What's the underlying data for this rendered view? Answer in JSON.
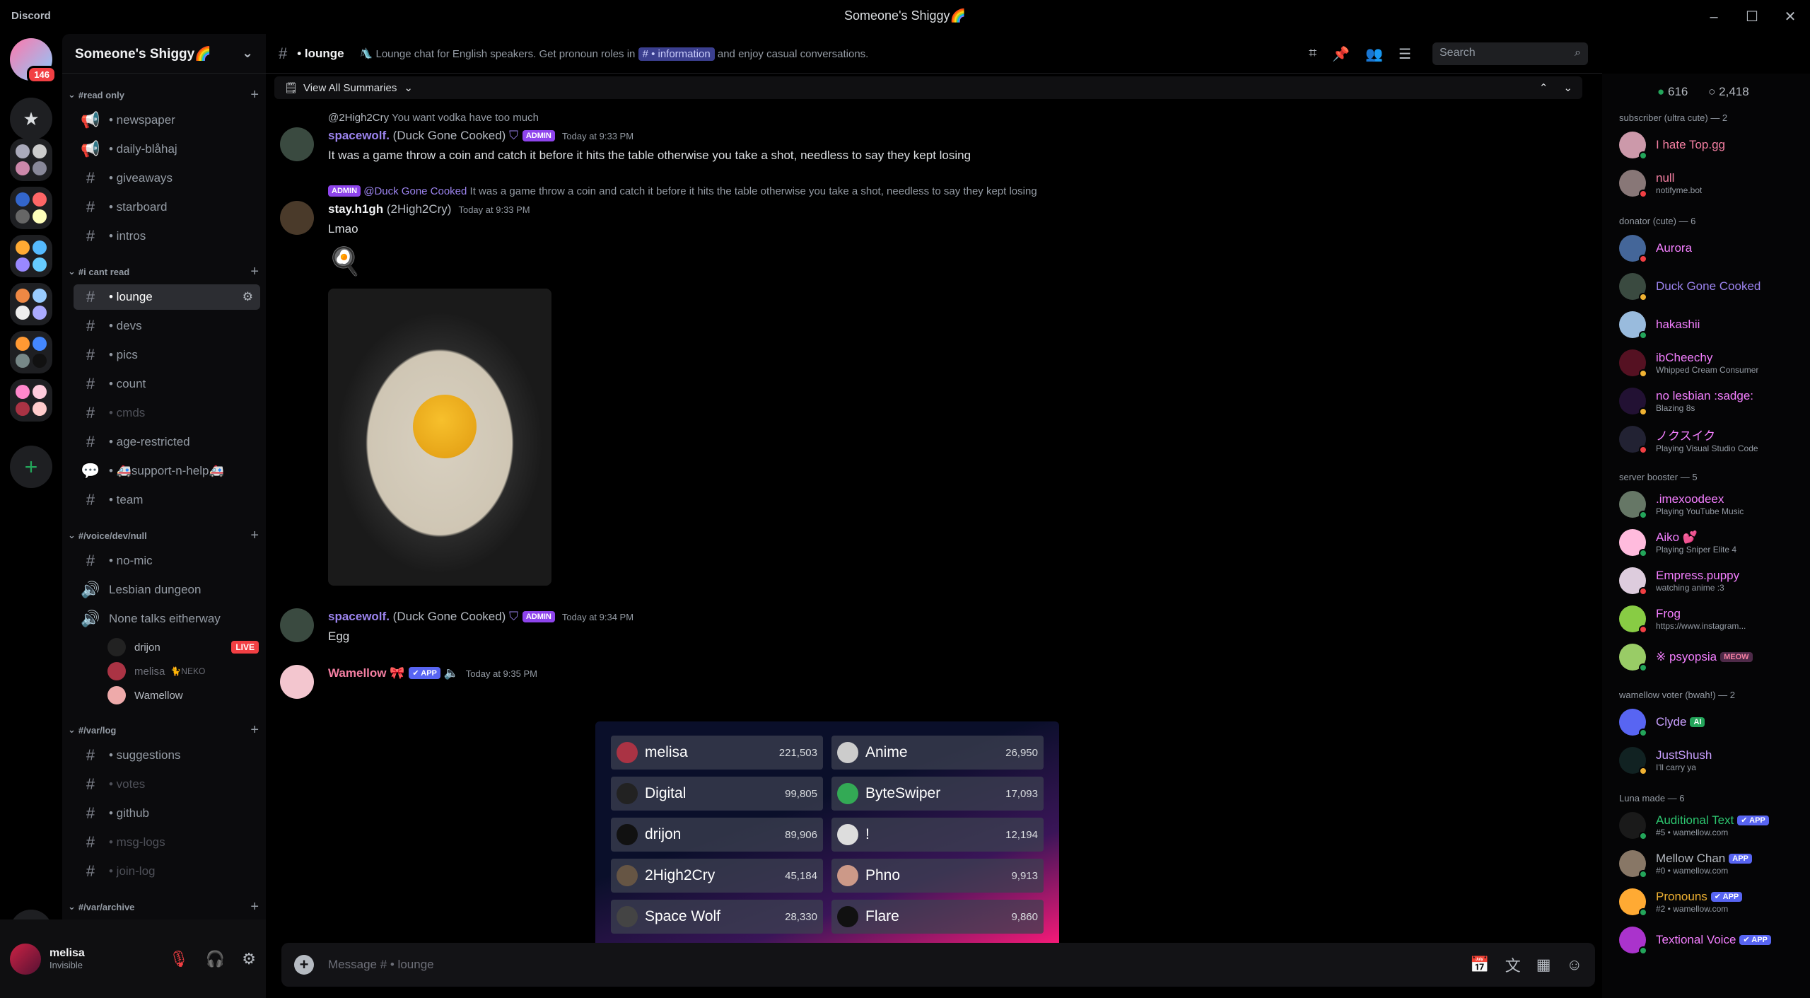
{
  "window": {
    "brand": "Discord",
    "title": "Someone's Shiggy🌈"
  },
  "guilds": {
    "badge": "146"
  },
  "server": {
    "name": "Someone's Shiggy🌈"
  },
  "categories": [
    {
      "name": "#read only",
      "channels": [
        {
          "label": "• newspaper",
          "icon": "megaphone"
        },
        {
          "label": "• daily-blåhaj",
          "icon": "megaphone"
        },
        {
          "label": "• giveaways",
          "icon": "hash"
        },
        {
          "label": "• starboard",
          "icon": "hash"
        },
        {
          "label": "• intros",
          "icon": "hash"
        }
      ]
    },
    {
      "name": "#i cant read",
      "channels": [
        {
          "label": "• lounge",
          "icon": "hash"
        },
        {
          "label": "• devs",
          "icon": "hash"
        },
        {
          "label": "• pics",
          "icon": "hash"
        },
        {
          "label": "• count",
          "icon": "hash"
        },
        {
          "label": "• cmds",
          "icon": "hash"
        },
        {
          "label": "• age-restricted",
          "icon": "hash"
        },
        {
          "label": "• 🚑support-n-help🚑",
          "icon": "forum"
        },
        {
          "label": "• team",
          "icon": "hash"
        }
      ]
    },
    {
      "name": "#/voice/dev/null",
      "channels": [
        {
          "label": "• no-mic",
          "icon": "hash"
        },
        {
          "label": "Lesbian dungeon",
          "icon": "speaker"
        },
        {
          "label": "None talks eitherway",
          "icon": "speaker"
        }
      ],
      "voice_users": [
        {
          "name": "drijon",
          "tag": "LIVE"
        },
        {
          "name": "melisa",
          "tag": "🐈NEKO"
        },
        {
          "name": "Wamellow",
          "tag": ""
        }
      ]
    },
    {
      "name": "#/var/log",
      "channels": [
        {
          "label": "• suggestions",
          "icon": "hash"
        },
        {
          "label": "• votes",
          "icon": "hash"
        },
        {
          "label": "• github",
          "icon": "hash"
        },
        {
          "label": "• msg-logs",
          "icon": "hash"
        },
        {
          "label": "• join-log",
          "icon": "hash"
        }
      ]
    },
    {
      "name": "#/var/archive",
      "channels": []
    }
  ],
  "user": {
    "name": "melisa",
    "status": "Invisible"
  },
  "channel": {
    "name": "• lounge",
    "topic_pre": "🛝 Lounge chat for English speakers. Get pronoun roles in",
    "topic_mention": "#  • information",
    "topic_post": "and enjoy casual conversations."
  },
  "search": {
    "placeholder": "Search"
  },
  "summary": {
    "label": "View All Summaries"
  },
  "messages": [
    {
      "reply_user": "@2High2Cry",
      "reply_text": "You want vodka have too much",
      "author": "spacewolf.",
      "nick": "(Duck Gone Cooked)",
      "tag": "ADMIN",
      "time": "Today at 9:33 PM",
      "text": "It was a game throw a coin and catch it before it hits the table otherwise you take a shot, needless to say they kept losing"
    },
    {
      "reply_tag": "ADMIN",
      "reply_user": "@Duck Gone Cooked",
      "reply_text": "It was a game throw a coin and catch it before it hits the table otherwise you take a shot, needless to say they kept losing",
      "author": "stay.h1gh",
      "nick": "(2High2Cry)",
      "time": "Today at 9:33 PM",
      "text": "Lmao"
    },
    {
      "author": "spacewolf.",
      "nick": "(Duck Gone Cooked)",
      "tag": "ADMIN",
      "time": "Today at 9:34 PM",
      "text": "Egg"
    },
    {
      "author": "Wamellow",
      "tag": "✔ APP",
      "time": "Today at 9:35 PM"
    }
  ],
  "leaderboard": [
    {
      "name": "melisa",
      "value": "221,503"
    },
    {
      "name": "Anime",
      "value": "26,950"
    },
    {
      "name": "Digital",
      "value": "99,805"
    },
    {
      "name": "ByteSwiper",
      "value": "17,093"
    },
    {
      "name": "drijon",
      "value": "89,906"
    },
    {
      "name": "!",
      "value": "12,194"
    },
    {
      "name": "2High2Cry",
      "value": "45,184"
    },
    {
      "name": "Phno",
      "value": "9,913"
    },
    {
      "name": "Space Wolf",
      "value": "28,330"
    },
    {
      "name": "Flare",
      "value": "9,860"
    }
  ],
  "composer": {
    "placeholder": "Message # • lounge"
  },
  "member_counts": {
    "online": "616",
    "offline": "2,418"
  },
  "member_groups": [
    {
      "title": "subscriber (ultra cute) — 2",
      "members": [
        {
          "name": "I hate Top.gg",
          "sub": "",
          "color": "#f47fa2",
          "tag": ""
        },
        {
          "name": "null",
          "sub": "notifyme.bot",
          "color": "#f47fa2",
          "tag": ""
        }
      ]
    },
    {
      "title": "donator (cute) — 6",
      "members": [
        {
          "name": "Aurora",
          "sub": "",
          "color": "#f47fff",
          "tag": ""
        },
        {
          "name": "Duck Gone Cooked",
          "sub": "",
          "color": "#9c84ef",
          "tag": ""
        },
        {
          "name": "hakashii",
          "sub": "",
          "color": "#f47fff",
          "tag": ""
        },
        {
          "name": "ibCheechy",
          "sub": "Whipped Cream Consumer",
          "color": "#f47fff",
          "tag": ""
        },
        {
          "name": "no lesbian :sadge:",
          "sub": "Blazing 8s",
          "color": "#f47fff",
          "tag": ""
        },
        {
          "name": "ノクスイク",
          "sub": "Playing Visual Studio Code",
          "color": "#f47fff",
          "tag": ""
        }
      ]
    },
    {
      "title": "server booster — 5",
      "members": [
        {
          "name": ".imexoodeex",
          "sub": "Playing YouTube Music",
          "color": "#f47fff",
          "tag": ""
        },
        {
          "name": "Aiko 💕",
          "sub": "Playing Sniper Elite 4",
          "color": "#f47fff",
          "tag": ""
        },
        {
          "name": "Empress.puppy",
          "sub": "watching anime :3",
          "color": "#f47fff",
          "tag": ""
        },
        {
          "name": "Frog",
          "sub": "https://www.instagram...",
          "color": "#f47fff",
          "tag": ""
        },
        {
          "name": "※ psyopsia",
          "sub": "",
          "color": "#f47fff",
          "tag": "MEOW"
        }
      ]
    },
    {
      "title": "wamellow voter (bwah!) — 2",
      "members": [
        {
          "name": "Clyde",
          "sub": "",
          "color": "#c9a0ff",
          "tag": "AI"
        },
        {
          "name": "JustShush",
          "sub": "I'll carry ya",
          "color": "#c9a0ff",
          "tag": ""
        }
      ]
    },
    {
      "title": "Luna made — 6",
      "members": [
        {
          "name": "Auditional Text",
          "sub": "#5 • wamellow.com",
          "color": "#2dc770",
          "tag": "✔ APP"
        },
        {
          "name": "Mellow Chan",
          "sub": "#0 • wamellow.com",
          "color": "#b5bac1",
          "tag": "APP"
        },
        {
          "name": "Pronouns",
          "sub": "#2 • wamellow.com",
          "color": "#f0b232",
          "tag": "✔ APP"
        },
        {
          "name": "Textional Voice",
          "sub": "",
          "color": "#f47fff",
          "tag": "✔ APP"
        }
      ]
    }
  ],
  "colors": {
    "accent": "#5865f2",
    "online": "#23a55a",
    "dnd": "#f23f43",
    "idle": "#f0b232"
  }
}
